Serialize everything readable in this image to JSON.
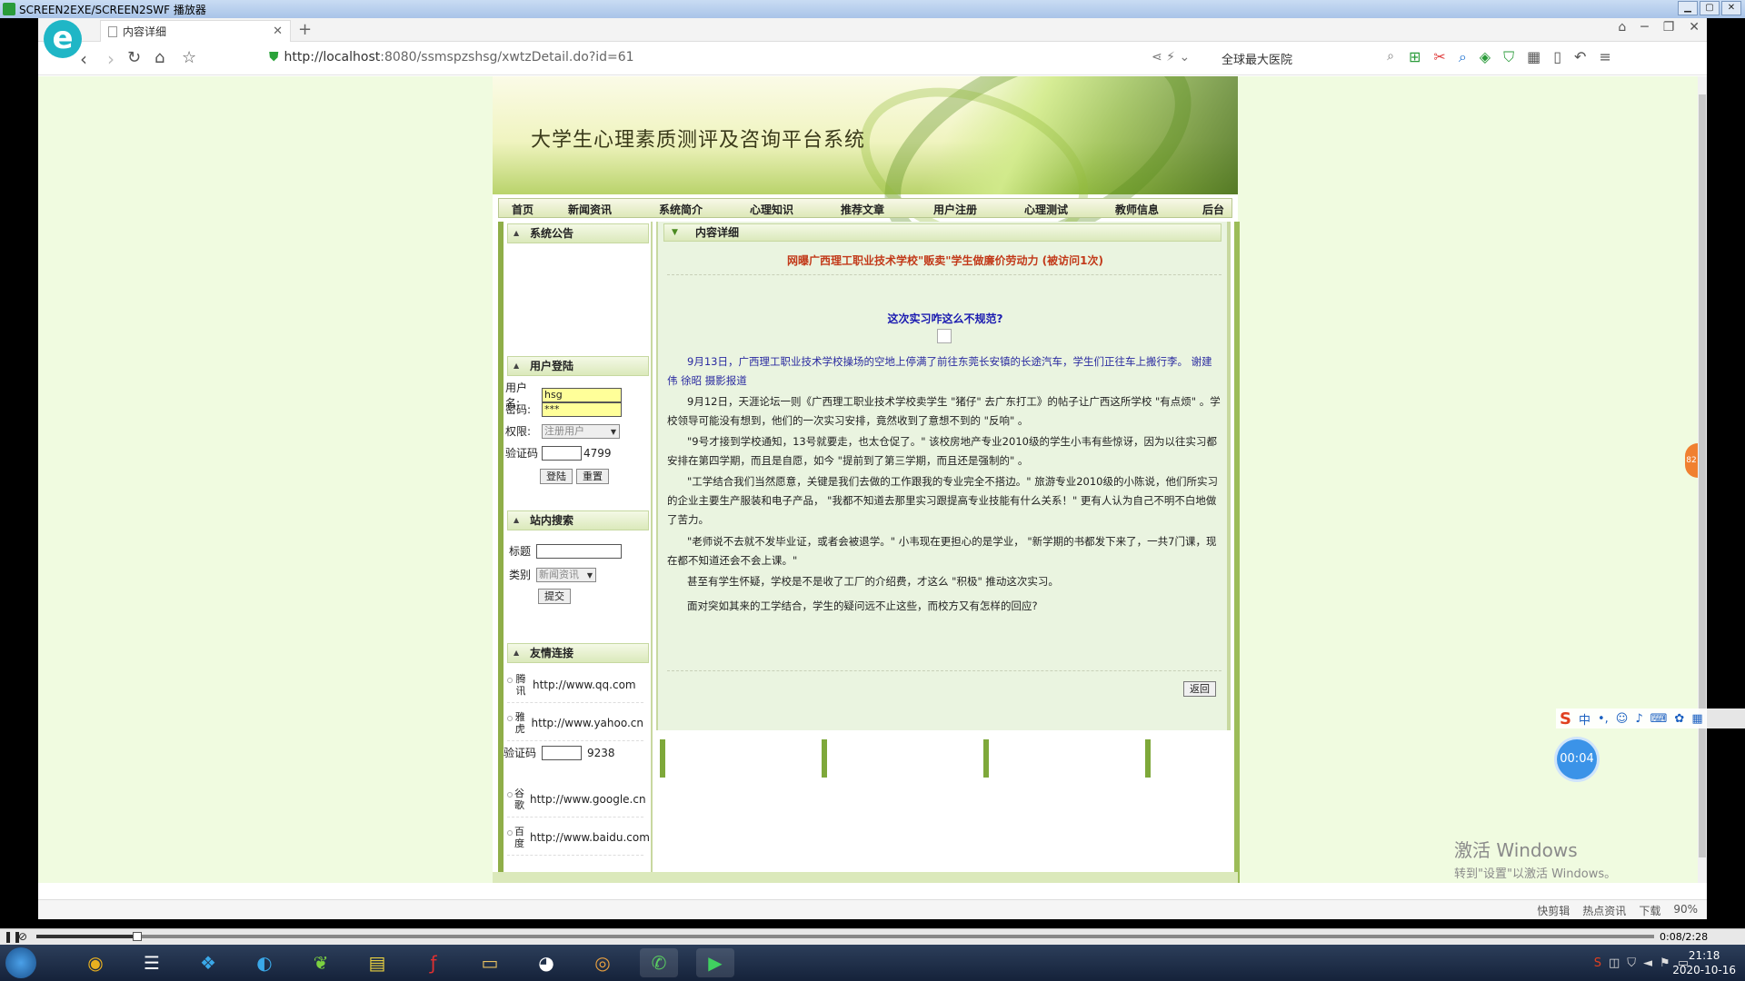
{
  "player": {
    "title": "SCREEN2EXE/SCREEN2SWF 播放器",
    "time": "0:08/2:28"
  },
  "browser": {
    "tab_title": "内容详细",
    "url_prefix": "http://",
    "url_host": "localhost",
    "url_path": ":8080/ssmspzshsg/xwtzDetail.do?id=61",
    "search_text": "全球最大医院",
    "status_items": [
      "快剪辑",
      "热点资讯",
      "下载",
      "90%"
    ]
  },
  "site": {
    "title": "大学生心理素质测评及咨询平台系统",
    "menu": [
      "首页",
      "新闻资讯",
      "系统简介",
      "心理知识",
      "推荐文章",
      "用户注册",
      "心理测试",
      "教师信息",
      "后台"
    ]
  },
  "sidebar": {
    "notice_title": "系统公告",
    "login": {
      "title": "用户登陆",
      "username_label": "用户名:",
      "username_value": "hsg",
      "password_label": "密码:",
      "password_value": "***",
      "role_label": "权限:",
      "role_value": "注册用户",
      "captcha_label": "验证码",
      "captcha_code": "4799",
      "login_button": "登陆",
      "reset_button": "重置"
    },
    "search": {
      "title": "站内搜索",
      "title_label": "标题",
      "category_label": "类别",
      "category_value": "新闻资讯",
      "submit_button": "提交"
    },
    "links": {
      "title": "友情连接",
      "items": [
        {
          "name": "腾讯",
          "url": "http://www.qq.com"
        },
        {
          "name": "雅虎",
          "url": "http://www.yahoo.cn"
        },
        {
          "name": "谷歌",
          "url": "http://www.google.cn"
        },
        {
          "name": "百度",
          "url": "http://www.baidu.com"
        }
      ]
    },
    "stray_captcha_label": "验证码",
    "stray_captcha_code": "9238"
  },
  "content": {
    "head": "内容详细",
    "title": "网曝广西理工职业技术学校\"贩卖\"学生做廉价劳动力 (被访问1次)",
    "subtitle": "这次实习咋这么不规范?",
    "paragraphs": [
      "9月13日，广西理工职业技术学校操场的空地上停满了前往东莞长安镇的长途汽车，学生们正往车上搬行李。 谢建伟 徐昭 摄影报道",
      "9月12日，天涯论坛一则《广西理工职业技术学校卖学生 \"猪仔\" 去广东打工》的帖子让广西这所学校 \"有点烦\" 。学校领导可能没有想到，他们的一次实习安排，竟然收到了意想不到的 \"反响\" 。",
      "\"9号才接到学校通知，13号就要走，也太仓促了。\" 该校房地产专业2010级的学生小韦有些惊讶，因为以往实习都安排在第四学期，而且是自愿，如今 \"提前到了第三学期，而且还是强制的\" 。",
      "\"工学结合我们当然愿意，关键是我们去做的工作跟我的专业完全不搭边。\" 旅游专业2010级的小陈说，他们所实习的企业主要生产服装和电子产品， \"我都不知道去那里实习跟提高专业技能有什么关系！\" 更有人认为自己不明不白地做了苦力。",
      "\"老师说不去就不发毕业证，或者会被退学。\" 小韦现在更担心的是学业， \"新学期的书都发下来了，一共7门课，现在都不知道还会不会上课。\"",
      "甚至有学生怀疑，学校是不是收了工厂的介绍费，才这么 \"积极\" 推动这次实习。",
      "面对突如其来的工学结合，学生的疑问远不止这些，而校方又有怎样的回应?"
    ],
    "back_button": "返回"
  },
  "overlay": {
    "timer": "00:04",
    "ime_cn": "中",
    "orange_badge": "82",
    "watermark_line1": "激活 Windows",
    "watermark_line2": "转到\"设置\"以激活 Windows。"
  },
  "taskbar": {
    "time": "21:18",
    "date": "2020-10-16"
  }
}
